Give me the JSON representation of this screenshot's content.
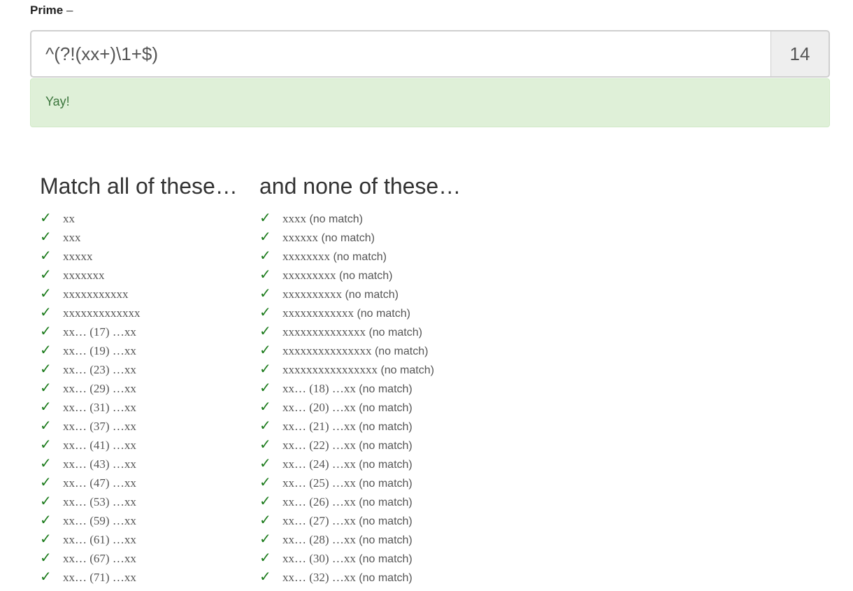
{
  "heading": {
    "name": "Prime",
    "dash": "–"
  },
  "regex": {
    "value": "^(?!(xx+)\\1+$)",
    "placeholder": ""
  },
  "score": "14",
  "alert": {
    "text": "Yay!"
  },
  "match": {
    "title": "Match all of these…",
    "items": [
      "xx",
      "xxx",
      "xxxxx",
      "xxxxxxx",
      "xxxxxxxxxxx",
      "xxxxxxxxxxxxx",
      "xx… (17) …xx",
      "xx… (19) …xx",
      "xx… (23) …xx",
      "xx… (29) …xx",
      "xx… (31) …xx",
      "xx… (37) …xx",
      "xx… (41) …xx",
      "xx… (43) …xx",
      "xx… (47) …xx",
      "xx… (53) …xx",
      "xx… (59) …xx",
      "xx… (61) …xx",
      "xx… (67) …xx",
      "xx… (71) …xx"
    ]
  },
  "nomatch": {
    "title": "and none of these…",
    "note": "(no match)",
    "items": [
      "xxxx",
      "xxxxxx",
      "xxxxxxxx",
      "xxxxxxxxx",
      "xxxxxxxxxx",
      "xxxxxxxxxxxx",
      "xxxxxxxxxxxxxx",
      "xxxxxxxxxxxxxxx",
      "xxxxxxxxxxxxxxxx",
      "xx… (18) …xx",
      "xx… (20) …xx",
      "xx… (21) …xx",
      "xx… (22) …xx",
      "xx… (24) …xx",
      "xx… (25) …xx",
      "xx… (26) …xx",
      "xx… (27) …xx",
      "xx… (28) …xx",
      "xx… (30) …xx",
      "xx… (32) …xx"
    ]
  },
  "icons": {
    "check": "✓",
    "check_name": "check-icon",
    "check_color": "#1a7a1a"
  },
  "colors": {
    "alert_bg": "#dff0d8",
    "alert_text": "#3c763d"
  }
}
